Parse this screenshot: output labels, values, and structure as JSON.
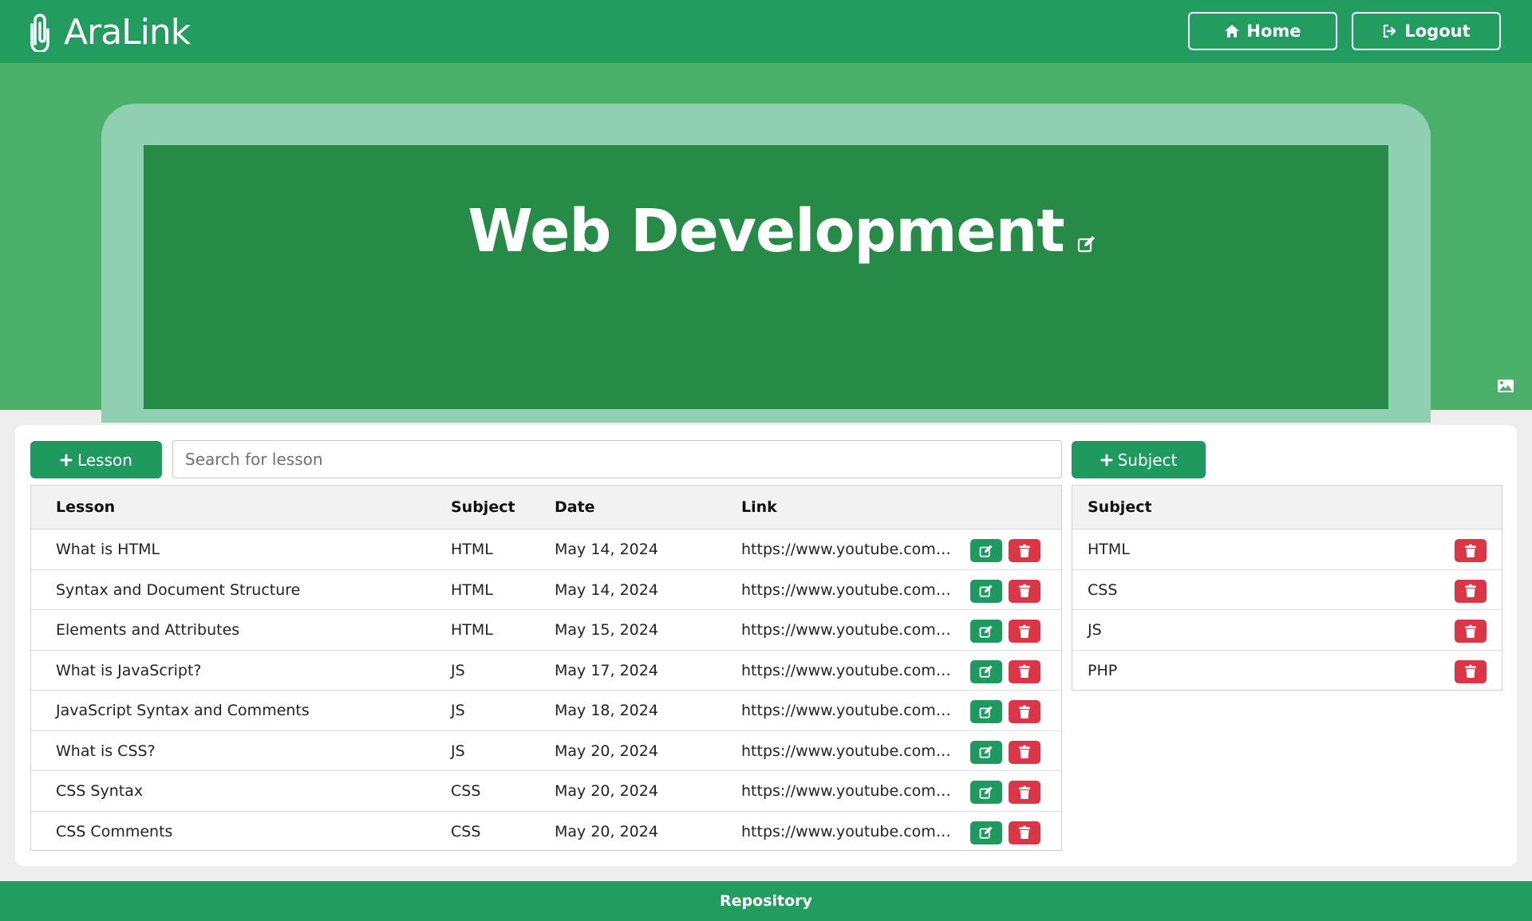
{
  "navbar": {
    "brand": "AraLink",
    "home_label": "Home",
    "logout_label": "Logout"
  },
  "banner": {
    "title": "Web Development"
  },
  "toolbar": {
    "add_lesson_label": "Lesson",
    "search_placeholder": "Search for lesson",
    "add_subject_label": "Subject"
  },
  "lessons_table": {
    "headers": {
      "lesson": "Lesson",
      "subject": "Subject",
      "date": "Date",
      "link": "Link"
    },
    "rows": [
      {
        "lesson": "What is HTML",
        "subject": "HTML",
        "date": "May 14, 2024",
        "link": "https://www.youtube.com/..."
      },
      {
        "lesson": "Syntax and Document Structure",
        "subject": "HTML",
        "date": "May 14, 2024",
        "link": "https://www.youtube.com/..."
      },
      {
        "lesson": "Elements and Attributes",
        "subject": "HTML",
        "date": "May 15, 2024",
        "link": "https://www.youtube.com/..."
      },
      {
        "lesson": "What is JavaScript?",
        "subject": "JS",
        "date": "May 17, 2024",
        "link": "https://www.youtube.com/..."
      },
      {
        "lesson": "JavaScript Syntax and Comments",
        "subject": "JS",
        "date": "May 18, 2024",
        "link": "https://www.youtube.com/..."
      },
      {
        "lesson": "What is CSS?",
        "subject": "JS",
        "date": "May 20, 2024",
        "link": "https://www.youtube.com/..."
      },
      {
        "lesson": "CSS Syntax",
        "subject": "CSS",
        "date": "May 20, 2024",
        "link": "https://www.youtube.com/..."
      },
      {
        "lesson": "CSS Comments",
        "subject": "CSS",
        "date": "May 20, 2024",
        "link": "https://www.youtube.com/..."
      }
    ]
  },
  "subjects_table": {
    "header": "Subject",
    "rows": [
      "HTML",
      "CSS",
      "JS",
      "PHP"
    ]
  },
  "footer": {
    "label": "Repository"
  },
  "colors": {
    "primary_green": "#229c5f",
    "banner_green": "#4ab06a",
    "banner_frame": "#90cfb1",
    "banner_inner": "#268b46",
    "danger_red": "#dc3545"
  },
  "icons": {
    "brand": "paperclip-icon",
    "home": "home-icon",
    "logout": "logout-icon",
    "edit": "edit-icon",
    "delete": "trash-icon",
    "change_image": "image-icon",
    "add": "plus-icon"
  }
}
